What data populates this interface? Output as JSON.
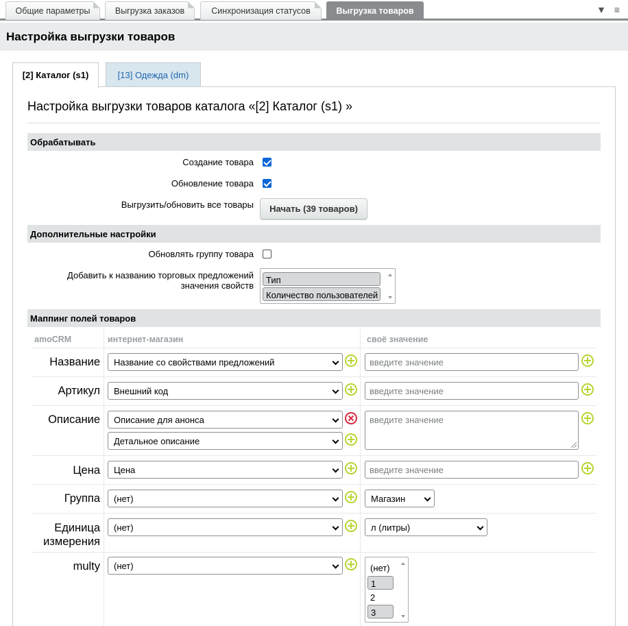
{
  "top_tabs": [
    "Общие параметры",
    "Выгрузка заказов",
    "Синхронизация статусов",
    "Выгрузка товаров"
  ],
  "page_title": "Настройка выгрузки товаров",
  "catalog_tabs": [
    "[2] Каталог (s1)",
    "[13] Одежда (dm)"
  ],
  "catalog_title": "Настройка выгрузки товаров каталога «[2] Каталог (s1) »",
  "process": {
    "heading": "Обрабатывать",
    "create_label": "Создание товара",
    "create_checked": true,
    "update_label": "Обновление товара",
    "update_checked": true,
    "export_all_label": "Выгрузить/обновить все товары",
    "start_button": "Начать (39 товаров)"
  },
  "extra": {
    "heading": "Дополнительные настройки",
    "update_group_label": "Обновлять группу товара",
    "update_group_checked": false,
    "offer_props_label_line1": "Добавить к названию торговых предложений",
    "offer_props_label_line2": "значения свойств",
    "offer_props_options": [
      "Тип",
      "Количество пользователей"
    ]
  },
  "mapping": {
    "heading": "Маппинг полей товаров",
    "col_amocrm": "amoCRM",
    "col_shop": "интернет-магазин",
    "col_own": "своё значение",
    "placeholder": "введите значение",
    "rows": {
      "name": {
        "label": "Название",
        "shop": "Название со свойствами предложений"
      },
      "article": {
        "label": "Артикул",
        "shop": "Внешний код"
      },
      "description": {
        "label": "Описание",
        "shop1": "Описание для анонса",
        "shop2": "Детальное описание"
      },
      "price": {
        "label": "Цена",
        "shop": "Цена"
      },
      "group": {
        "label": "Группа",
        "shop": "(нет)",
        "own": "Магазин"
      },
      "unit": {
        "label_line1": "Единица",
        "label_line2": "измерения",
        "shop": "(нет)",
        "own": "л (литры)"
      },
      "multy": {
        "label": "multy",
        "shop": "(нет)",
        "own_options": [
          "(нет)",
          "1",
          "2",
          "3"
        ]
      }
    }
  }
}
